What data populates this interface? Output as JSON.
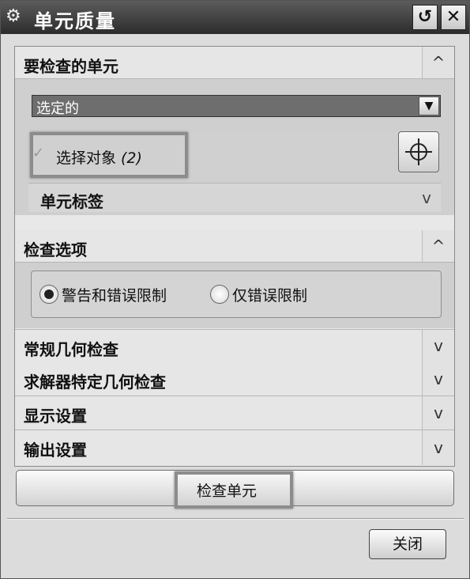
{
  "window": {
    "title": "单元质量",
    "icon": "gear-icon",
    "reset_icon": "reset-icon",
    "close_icon": "close-icon"
  },
  "sections": {
    "elements_to_check": {
      "title": "要检查的单元",
      "expanded": true,
      "chevron": "^",
      "select_dropdown": {
        "value": "选定的"
      },
      "select_object": {
        "label": "选择对象",
        "count": "(2)"
      },
      "element_label": {
        "title": "单元标签",
        "chevron": "v"
      }
    },
    "check_options": {
      "title": "检查选项",
      "expanded": true,
      "chevron": "^",
      "radios": [
        {
          "label": "警告和错误限制",
          "selected": true
        },
        {
          "label": "仅错误限制",
          "selected": false
        }
      ]
    },
    "collapsed": [
      {
        "title": "常规几何检查",
        "chevron": "v"
      },
      {
        "title": "求解器特定几何检查",
        "chevron": "v"
      },
      {
        "title": "显示设置",
        "chevron": "v"
      },
      {
        "title": "输出设置",
        "chevron": "v"
      }
    ]
  },
  "actions": {
    "check_elements": "检查单元",
    "close": "关闭"
  },
  "colors": {
    "titlebar": "#3c3c3c",
    "panel": "#e6e6e6",
    "section_body": "#cfcfcf",
    "combo": "#6e6e6e"
  }
}
